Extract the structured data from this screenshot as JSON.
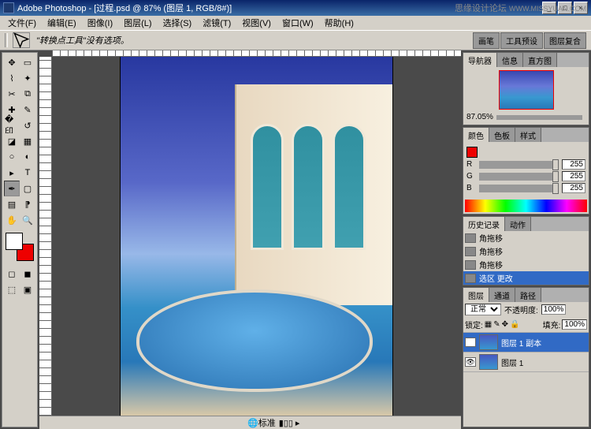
{
  "title": "Adobe Photoshop - [过程.psd @ 87% (图层 1, RGB/8#)]",
  "watermark": {
    "text1": "思缘设计论坛",
    "text2": "WWW.MISSYUAN.COM"
  },
  "menu": {
    "file": "文件(F)",
    "edit": "编辑(E)",
    "image": "图像(I)",
    "layer": "图层(L)",
    "select": "选择(S)",
    "filter": "滤镜(T)",
    "view": "视图(V)",
    "window": "窗口(W)",
    "help": "帮助(H)"
  },
  "optbar": {
    "hint": "\"转换点工具\"没有选项。",
    "tabs": [
      "画笔",
      "工具预设",
      "图层复合"
    ]
  },
  "status": {
    "zoom": "标准"
  },
  "panels": {
    "nav": {
      "tabs": [
        "导航器",
        "信息",
        "直方图"
      ],
      "zoom": "87.05%"
    },
    "color": {
      "tabs": [
        "颜色",
        "色板",
        "样式"
      ],
      "r": "255",
      "g": "255",
      "b": "255"
    },
    "history": {
      "tabs": [
        "历史记录",
        "动作"
      ],
      "items": [
        "角拖移",
        "角拖移",
        "角拖移",
        "选区 更改"
      ]
    },
    "layers": {
      "tabs": [
        "图层",
        "通道",
        "路径"
      ],
      "blend": "正常",
      "opacity_label": "不透明度:",
      "opacity": "100%",
      "lock_label": "锁定:",
      "fill_label": "填充:",
      "fill": "100%",
      "items": [
        "图层 1 副本",
        "图层 1"
      ]
    }
  }
}
